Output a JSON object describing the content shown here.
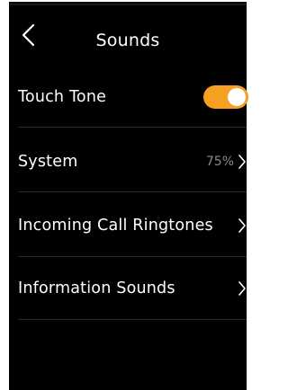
{
  "header": {
    "title": "Sounds",
    "back_icon": "chevron-left-icon"
  },
  "settings": {
    "touch_tone": {
      "label": "Touch Tone",
      "enabled": true,
      "toggle_color": "#f5a020"
    },
    "system": {
      "label": "System",
      "value": "75%"
    },
    "incoming_call": {
      "label": "Incoming Call Ringtones"
    },
    "information": {
      "label": "Information Sounds"
    }
  },
  "colors": {
    "background": "#000000",
    "text": "#ffffff",
    "accent": "#f5a020",
    "divider": "#2c2c2c",
    "secondary_text": "#8c8c8c"
  }
}
